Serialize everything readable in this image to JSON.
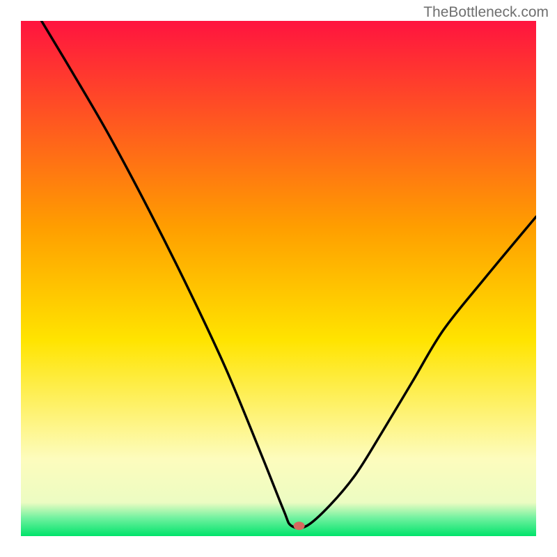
{
  "watermark": "TheBottleneck.com",
  "chart_data": {
    "type": "line",
    "title": "",
    "xlabel": "",
    "ylabel": "",
    "xlim": [
      0,
      100
    ],
    "ylim": [
      0,
      100
    ],
    "annotations": [],
    "series": [
      {
        "name": "curve",
        "x": [
          4,
          10,
          17,
          25,
          33,
          40,
          47,
          51,
          52.5,
          55.5,
          60,
          65,
          70,
          76,
          82,
          90,
          100
        ],
        "y": [
          100,
          90,
          78,
          63,
          47,
          32,
          15,
          5,
          2,
          2,
          6,
          12,
          20,
          30,
          40,
          50,
          62
        ]
      }
    ],
    "marker": {
      "x": 54,
      "y": 2
    },
    "gradient_stops": [
      {
        "offset": 0.0,
        "color": "#ff143f"
      },
      {
        "offset": 0.4,
        "color": "#ff9e00"
      },
      {
        "offset": 0.62,
        "color": "#ffe400"
      },
      {
        "offset": 0.85,
        "color": "#fdfcbd"
      },
      {
        "offset": 0.935,
        "color": "#ecfcc2"
      },
      {
        "offset": 0.965,
        "color": "#70f19f"
      },
      {
        "offset": 1.0,
        "color": "#00e36a"
      }
    ]
  }
}
